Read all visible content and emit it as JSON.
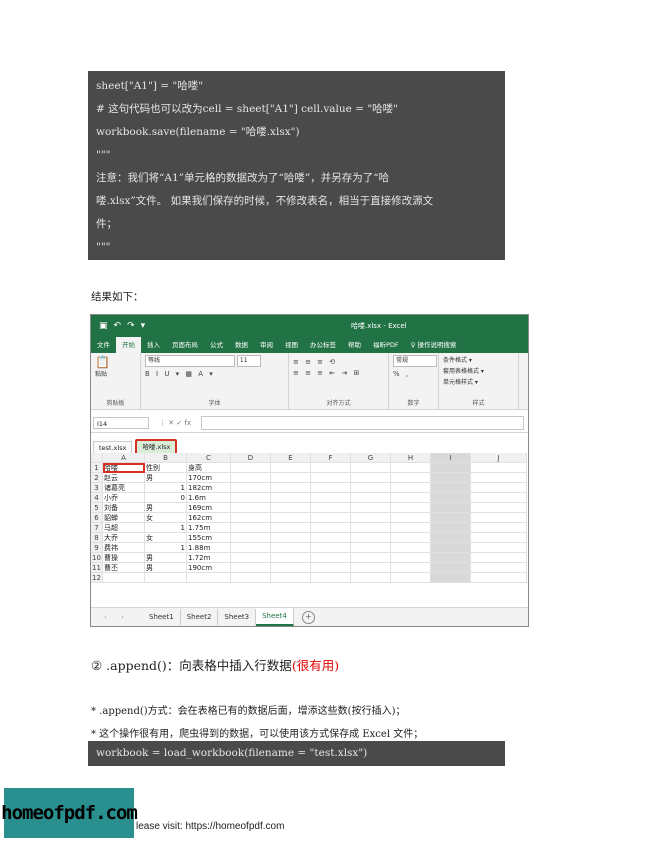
{
  "code_block_1": {
    "lines": [
      "sheet[\"A1\"] = \"哈喽\"",
      "# 这句代码也可以改为cell = sheet[\"A1\"] cell.value = \"哈喽\"",
      "workbook.save(filename = \"哈喽.xlsx\")",
      "\"\"\"",
      "注意：我们将“A1”单元格的数据改为了“哈喽”，并另存为了“哈",
      "喽.xlsx”文件。 如果我们保存的时候，不修改表名，相当于直接修改源文",
      "件；",
      "\"\"\""
    ]
  },
  "result_label": "结果如下：",
  "excel": {
    "window_title": "哈喽.xlsx - Excel",
    "ribbon_tabs": [
      "文件",
      "开始",
      "插入",
      "页面布局",
      "公式",
      "数据",
      "审阅",
      "视图",
      "办公标签",
      "帮助",
      "福昕PDF",
      "♀ 操作说明搜索"
    ],
    "ribbon_groups": {
      "clipboard": "剪贴板",
      "paste": "粘贴",
      "font": "字体",
      "font_name": "等线",
      "font_size": "11",
      "alignment": "对齐方式",
      "number": "数字",
      "number_format": "常规",
      "styles": "样式",
      "conditional_format": "条件格式 ▾",
      "table_format": "套用表格格式 ▾",
      "cell_styles": "单元格样式 ▾"
    },
    "name_box": "I14",
    "file_tabs": [
      "test.xlsx",
      "哈喽.xlsx"
    ],
    "columns": [
      "A",
      "B",
      "C",
      "D",
      "E",
      "F",
      "G",
      "H",
      "I",
      "J"
    ],
    "rows": [
      {
        "n": "1",
        "a": "哈喽",
        "b": "性别",
        "c": "身高"
      },
      {
        "n": "2",
        "a": "赵云",
        "b": "男",
        "c": "170cm"
      },
      {
        "n": "3",
        "a": "诸葛亮",
        "b": "1",
        "c": "182cm"
      },
      {
        "n": "4",
        "a": "小乔",
        "b": "0",
        "c": "1.6m"
      },
      {
        "n": "5",
        "a": "刘备",
        "b": "男",
        "c": "169cm"
      },
      {
        "n": "6",
        "a": "貂蝉",
        "b": "女",
        "c": "162cm"
      },
      {
        "n": "7",
        "a": "马超",
        "b": "1",
        "c": "1.75m"
      },
      {
        "n": "8",
        "a": "大乔",
        "b": "女",
        "c": "155cm"
      },
      {
        "n": "9",
        "a": "费祎",
        "b": "1",
        "c": "1.88m"
      },
      {
        "n": "10",
        "a": "曹操",
        "b": "男",
        "c": "1.72m"
      },
      {
        "n": "11",
        "a": "曹丕",
        "b": "男",
        "c": "190cm"
      },
      {
        "n": "12",
        "a": "",
        "b": "",
        "c": ""
      }
    ],
    "sheet_tabs": [
      "Sheet1",
      "Sheet2",
      "Sheet3",
      "Sheet4"
    ]
  },
  "section_title": {
    "prefix": "② .append()：向表格中插入行数据",
    "highlight": "(很有用)"
  },
  "bullets": [
    "* .append()方式：会在表格已有的数据后面，增添这些数(按行插入)；",
    "* 这个操作很有用，爬虫得到的数据，可以使用该方式保存成 Excel 文件；"
  ],
  "code_block_2": {
    "line": "workbook = load_workbook(filename = \"test.xlsx\")"
  },
  "logo_text": "homeofpdf.com",
  "footer_text": "lease visit: https://homeofpdf.com"
}
